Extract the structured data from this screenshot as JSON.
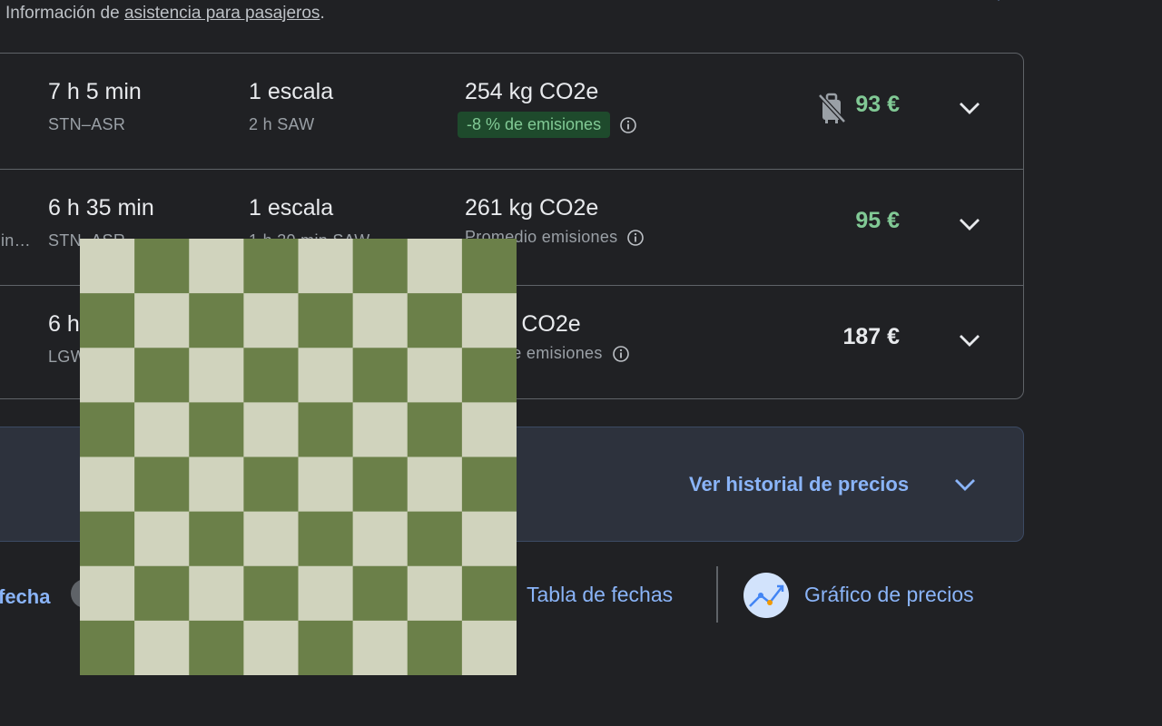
{
  "top_note": {
    "prefix": "Información de ",
    "link": "asistencia para pasajeros",
    "suffix": "."
  },
  "flights": [
    {
      "duration": "7 h 5 min",
      "route": "STN–ASR",
      "stops": "1 escala",
      "stop_info": "2 h SAW",
      "co2": "254 kg CO2e",
      "emissions": "-8 % de emisiones",
      "price": "93 €",
      "no_bag": true
    },
    {
      "duration": "6 h 35 min",
      "route": "STN–ASR",
      "stops": "1 escala",
      "stop_info": "1 h 30 min SAW",
      "co2": "261 kg CO2e",
      "emissions": "Promedio emisiones",
      "price": "95 €",
      "cut_text": "in…"
    },
    {
      "duration": "6 h",
      "route": "LGW",
      "co2": "kg CO2e",
      "emissions": "de emisiones",
      "price": "187 €"
    }
  ],
  "history": {
    "link": "Ver historial de precios"
  },
  "bottom": {
    "fecha": "fecha",
    "tabla": "Tabla de fechas",
    "grafico": "Gráfico de precios"
  },
  "colors": {
    "background": "#202124",
    "link": "#8ab4f8",
    "price_low": "#81c995",
    "checker_dark": "#6b8049",
    "checker_light": "#d0d3bd"
  },
  "icons": [
    "chevron-down-icon",
    "info-icon",
    "no-carry-on-bag-icon",
    "price-graph-icon"
  ]
}
